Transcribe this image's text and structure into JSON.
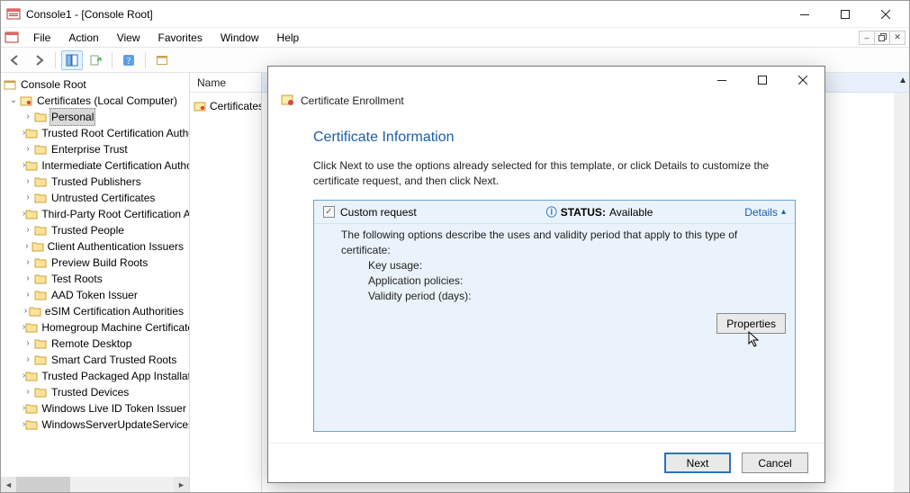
{
  "window": {
    "title": "Console1 - [Console Root]"
  },
  "menubar": {
    "file": "File",
    "action": "Action",
    "view": "View",
    "favorites": "Favorites",
    "window": "Window",
    "help": "Help"
  },
  "tree": {
    "root": "Console Root",
    "certs_node": "Certificates (Local Computer)",
    "items": [
      "Personal",
      "Trusted Root Certification Authorities",
      "Enterprise Trust",
      "Intermediate Certification Authorities",
      "Trusted Publishers",
      "Untrusted Certificates",
      "Third-Party Root Certification Authorities",
      "Trusted People",
      "Client Authentication Issuers",
      "Preview Build Roots",
      "Test Roots",
      "AAD Token Issuer",
      "eSIM Certification Authorities",
      "Homegroup Machine Certificates",
      "Remote Desktop",
      "Smart Card Trusted Roots",
      "Trusted Packaged App Installation Authorities",
      "Trusted Devices",
      "Windows Live ID Token Issuer",
      "WindowsServerUpdateServices"
    ]
  },
  "list": {
    "header": "Name",
    "row0": "Certificates"
  },
  "dialog": {
    "title": "Certificate Enrollment",
    "heading": "Certificate Information",
    "instruction": "Click Next to use the options already selected for this template, or click Details to customize the certificate request, and then click Next.",
    "template_name": "Custom request",
    "status_label": "STATUS:",
    "status_value": "Available",
    "details": "Details",
    "body_line1": "The following options describe the uses and validity period that apply to this type of certificate:",
    "body_line2": "Key usage:",
    "body_line3": "Application policies:",
    "body_line4": "Validity period (days):",
    "properties": "Properties",
    "next": "Next",
    "cancel": "Cancel"
  }
}
